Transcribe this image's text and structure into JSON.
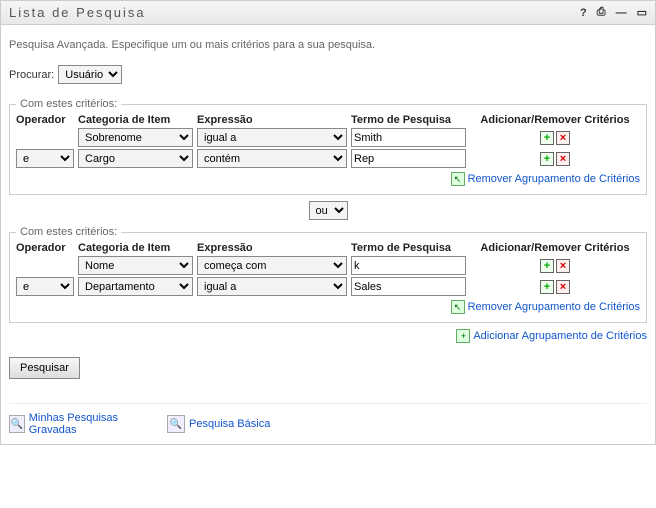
{
  "window": {
    "title": "Lista de Pesquisa"
  },
  "subtitle": "Pesquisa Avançada. Especifique um ou mais critérios para a sua pesquisa.",
  "search_for": {
    "label": "Procurar:",
    "value": "Usuário"
  },
  "groups_legend": "Com estes critérios:",
  "headers": {
    "operator": "Operador",
    "category": "Categoria de Item",
    "expression": "Expressão",
    "term": "Termo de Pesquisa",
    "addremove": "Adicionar/Remover Critérios"
  },
  "group1": {
    "rows": [
      {
        "operator": "",
        "category": "Sobrenome",
        "expression": "igual a",
        "term": "Smith"
      },
      {
        "operator": "e",
        "category": "Cargo",
        "expression": "contém",
        "term": "Rep"
      }
    ]
  },
  "group_join_operator": "ou",
  "group2": {
    "rows": [
      {
        "operator": "",
        "category": "Nome",
        "expression": "começa com",
        "term": "k"
      },
      {
        "operator": "e",
        "category": "Departamento",
        "expression": "igual a",
        "term": "Sales"
      }
    ]
  },
  "links": {
    "remove_group": "Remover Agrupamento de Critérios",
    "add_group": "Adicionar Agrupamento de Critérios"
  },
  "buttons": {
    "search": "Pesquisar"
  },
  "footer": {
    "saved_searches": "Minhas Pesquisas Gravadas",
    "basic_search": "Pesquisa Básica"
  }
}
